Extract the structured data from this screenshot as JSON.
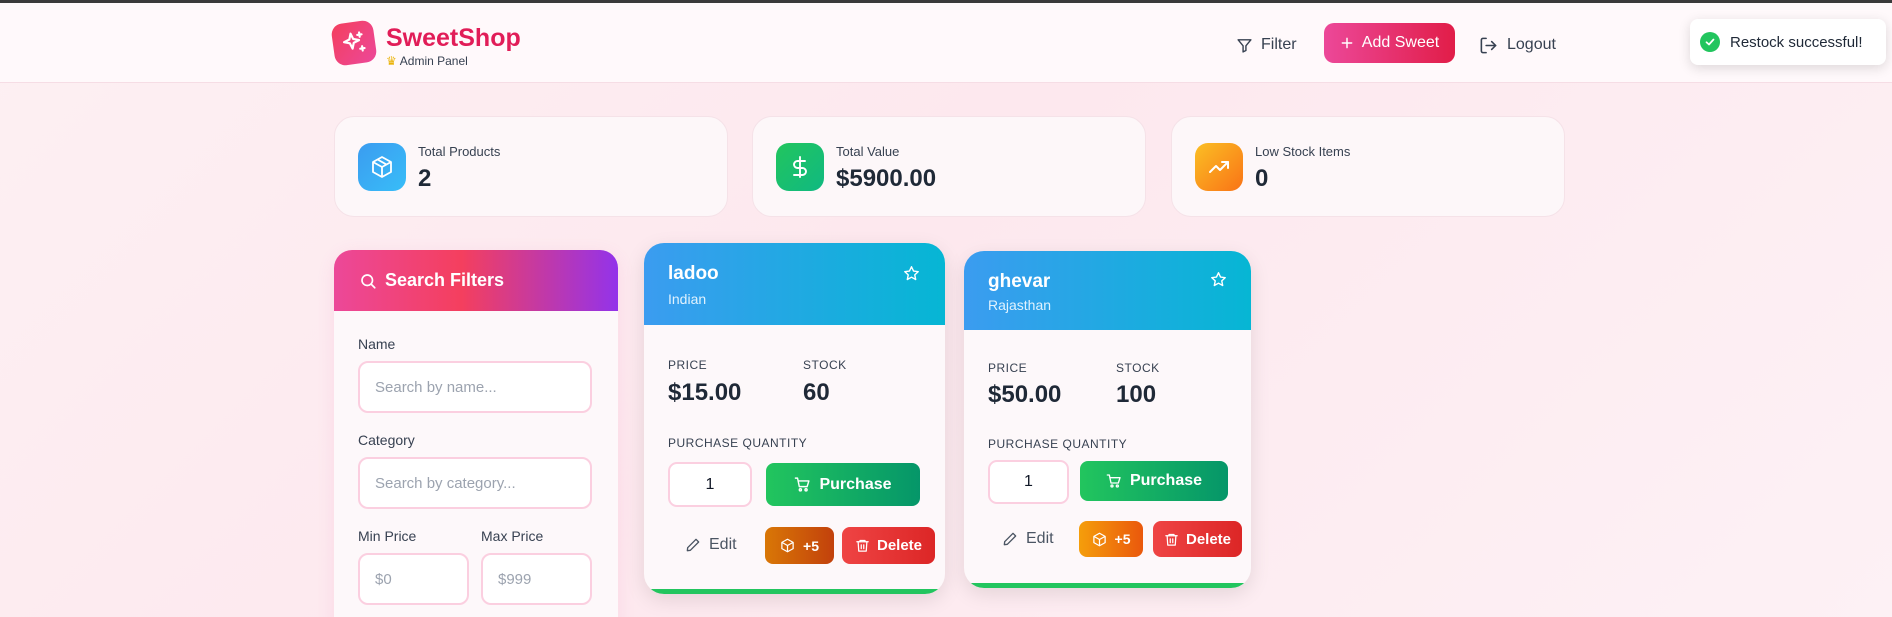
{
  "header": {
    "brand_title": "SweetShop",
    "brand_subtitle": "Admin Panel",
    "nav": {
      "filter_label": "Filter",
      "add_label": "Add Sweet",
      "logout_label": "Logout"
    }
  },
  "toast": {
    "message": "Restock successful!"
  },
  "stats": [
    {
      "label": "Total Products",
      "value": "2",
      "icon": "cube-icon",
      "color": "#3b82f6"
    },
    {
      "label": "Total Value",
      "value": "$5900.00",
      "icon": "dollar-icon",
      "color": "#22c55e"
    },
    {
      "label": "Low Stock Items",
      "value": "0",
      "icon": "trending-up-icon",
      "color": "#f59e0b"
    }
  ],
  "filters": {
    "title": "Search Filters",
    "name_label": "Name",
    "name_placeholder": "Search by name...",
    "category_label": "Category",
    "category_placeholder": "Search by category...",
    "min_price_label": "Min Price",
    "min_price_placeholder": "$0",
    "max_price_label": "Max Price",
    "max_price_placeholder": "$999"
  },
  "products": [
    {
      "name": "ladoo",
      "category": "Indian",
      "price_label": "PRICE",
      "price": "$15.00",
      "stock_label": "STOCK",
      "stock": "60",
      "quantity_label": "PURCHASE QUANTITY",
      "quantity": "1",
      "purchase_label": "Purchase",
      "edit_label": "Edit",
      "restock_label": "+5",
      "delete_label": "Delete"
    },
    {
      "name": "ghevar",
      "category": "Rajasthan",
      "price_label": "PRICE",
      "price": "$50.00",
      "stock_label": "STOCK",
      "stock": "100",
      "quantity_label": "PURCHASE QUANTITY",
      "quantity": "1",
      "purchase_label": "Purchase",
      "edit_label": "Edit",
      "restock_label": "+5",
      "delete_label": "Delete"
    }
  ],
  "colors": {
    "brand": "#e11d58",
    "accent_pink": "#ec4899",
    "card_header": "#06b6d4",
    "success": "#22c55e",
    "restock": "#d97706",
    "danger": "#ef4444"
  }
}
